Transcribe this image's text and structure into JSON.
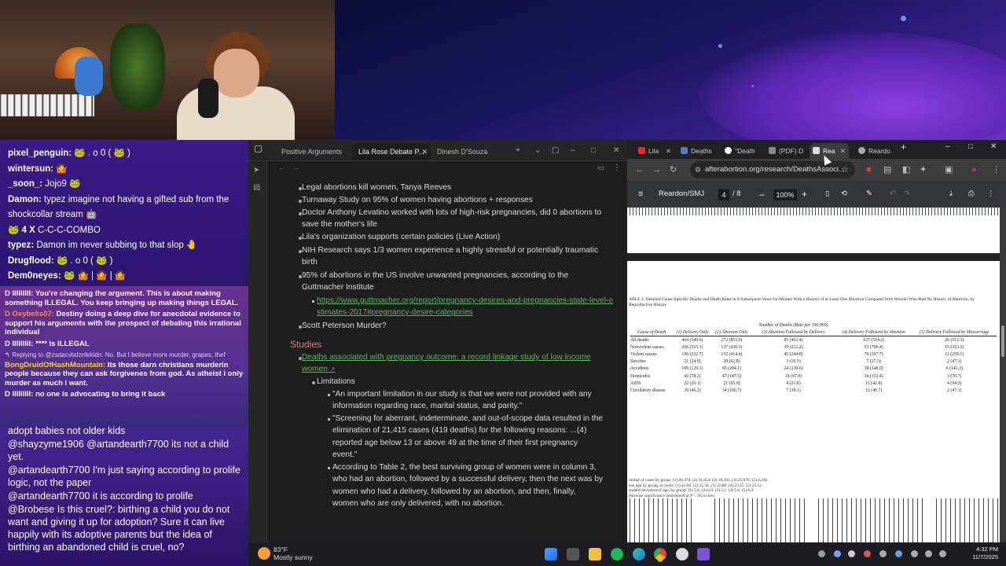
{
  "chat": {
    "upper": [
      {
        "user": "pixel_penguin:",
        "text": "🐸 . o 0 ( 🐸 )"
      },
      {
        "user": "wintersun:",
        "text": "🤷"
      },
      {
        "user": "_soon_:",
        "text": "Jojo9 🐸"
      },
      {
        "user": "Damon:",
        "text": "typez imagine not having a gifted sub from the"
      },
      {
        "user": "",
        "text": "shockcollar stream 🤖"
      },
      {
        "user": "🐸 4 X",
        "text": "C-C-C-COMBO"
      },
      {
        "user": "typez:",
        "text": "Damon im never subbing to that slop 🤚"
      },
      {
        "user": "Drugflood:",
        "text": "🐸 . o 0 ( 🐸 )"
      },
      {
        "user": "Dem0neyes:",
        "text": "🐸 🤷 | 🤷 | 🤷"
      }
    ],
    "highlight": [
      {
        "user": "D lllllllll:",
        "text": "You're changing the argument. This is about making something ILLEGAL. You keep bringing up making things LEGAL.",
        "cls": ""
      },
      {
        "user": "D Oxybelis07:",
        "text": "Destiny doing a deep dive for anecdotal evidence to support his arguments with the prospect of debating this irrational individual",
        "cls": "o"
      },
      {
        "user": "D lllllllll:",
        "text": "**** is ILLEGAL",
        "cls": ""
      },
      {
        "user": "↰",
        "text": "Replying to @zsdacvbdznfekldn: No. But I believe more murder, grapes, thef",
        "cls": "sm"
      },
      {
        "user": "BongDruidOfHashMountain:",
        "text": "Its those darn christians murderin people because they can ask forgivenes from god. As atheist i only murder as much i want.",
        "cls": "y"
      },
      {
        "user": "D lllllllll:",
        "text": "no one is advocating to bring it back",
        "cls": ""
      }
    ],
    "lower": [
      {
        "user": "",
        "text": "adopt babies not older kids"
      },
      {
        "user": "@shayzyme1906",
        "text": "@artandearth7700 its not a child yet."
      },
      {
        "user": "@artandearth7700",
        "text": "I'm just saying according to prolife logic, not the paper"
      },
      {
        "user": "@artandearth7700",
        "text": "it is according to prolife"
      },
      {
        "user": "@Brobese",
        "text": "Is this cruel?: birthing a child you do not want and giving it up for adoption? Sure it can live happily with its adoptive parents but the idea of birthing an abandoned child is cruel, no?"
      }
    ]
  },
  "obsidian": {
    "tabs": [
      "Positive Arguments",
      "Lila Rose Debate P...",
      "Dinesh D'Souza"
    ],
    "items": [
      "Legal abortions kill women, Tanya Reeves",
      "Turnaway Study on 95% of women having abortions + responses",
      "Doctor Anthony Levatino worked with lots of high-risk pregnancies, did 0 abortions to save the mother's life",
      "Lila's organization supports certain policies (Live Action)",
      "NIH Research says 1/3 women experience a highly stressful or potentially traumatic birth",
      "95% of abortions in the US involve unwanted pregnancies, according to the Guttmacher Institute"
    ],
    "link1": "https://www.guttmacher.org/report/pregnancy-desires-and-pregnancies-state-level-estimates-2017#pregnancy-desire-categories",
    "item_last": "Scott Peterson Murder?",
    "heading": "Studies",
    "study_link": "Deaths associated with pregnancy outcome: a record linkage study of low income women",
    "limitations": "Limitations",
    "quotes": [
      "\"An important limitation in our study is that we were not provided with any information regarding race, marital status, and parity.\"",
      "\"Screening for aberrant, indeterminate, and out-of-scope data resulted in the elimination of 21,415 cases (419 deaths) for the following reasons: ...(4) reported age below 13 or above 49 at the time of their first pregnancy event.\"",
      "According to Table 2, the best surviving group of women were in column 3, who had an abortion, followed by a successful delivery, then the next was by women who had a delivery, followed by an abortion, and then, finally, women who are only delivered, with no abortion."
    ]
  },
  "chrome": {
    "tabs": [
      "Lila",
      "Deaths",
      "\"Death",
      "(PDF) D",
      "Rea",
      "Reardo"
    ],
    "url": "afterabortion.org/research/DeathsAssoci...",
    "pdf_title": "Reardon/SMJ",
    "page_current": "4",
    "page_total": "/ 8",
    "zoom": "100%",
    "table_caption": "ABLE 2. Detailed Cause-Specific Deaths and Death Rates in 8 Subsequent Years for Women With a History of at Least One Abortion Compared With Women Who Had No History of Abortion, by Reproductive History",
    "table_subhead": "Number of Deaths (Rate per 100,000)",
    "table_cols": [
      "Cause of Death",
      "(1) Delivery Only",
      "(2) Abortion Only",
      "(3) Abortion Followed by Delivery",
      "(4) Delivery Followed by Abortion",
      "(5) Delivery Followed by Miscarriage"
    ],
    "table_rows": [
      [
        "All deaths",
        "464 (549.6)",
        "272 (853.9)",
        "85 (462.4)",
        "137 (514.2)",
        "26 (612.3)"
      ],
      [
        "Nonviolent causes",
        "266 (315.1)",
        "137 (430.1)",
        "39 (212.2)",
        "53 (706.4)",
        "15 (353.3)"
      ],
      [
        "Violent causes",
        "196 (232.7)",
        "132 (414.4)",
        "45 (244.8)",
        "79 (307.7)",
        "11 (259.1)"
      ],
      [
        "Suicides",
        "21 (24.9)",
        "20 (62.8)",
        "3 (16.3)",
        "7 (27.3)",
        "2 (47.1)"
      ],
      [
        "Accidents",
        "109 (129.1)",
        "65 (204.1)",
        "24 (130.6)",
        "38 (148.0)",
        "6 (141.3)"
      ],
      [
        "Homicides",
        "66 (78.2)",
        "47 (147.5)",
        "18 (97.9)",
        "34 (132.4)",
        "3 (70.7)"
      ],
      [
        "AIDS",
        "22 (26.1)",
        "21 (65.9)",
        "4 (21.8)",
        "11 (42.8)",
        "4 (94.2)"
      ],
      [
        "Circulatory disease",
        "39 (46.2)",
        "34 (106.7)",
        "7 (38.1)",
        "12 (46.7)",
        "2 (47.1)"
      ]
    ],
    "footnotes": [
      "umber of cases by group: (1) 84,470. (2) 31,854. (3) 18,383. (4) 25,676. (5) 4,246.",
      "ean age by group, in years: (1) 23.66. (2) 25.58. (3) 23.88. (4) 23.15. (5) 25.12.",
      "andard deviation of age, by group: (1) 5.8. (2) 6.6. (3) 5.1. (4) 5.0. (5) 6.0.",
      "Pairwise significance determined at P < .05 or less."
    ]
  },
  "taskbar": {
    "temp": "83°F",
    "weather": "Mostly sunny",
    "time": "4:32 PM",
    "date": "11/7/2025"
  }
}
